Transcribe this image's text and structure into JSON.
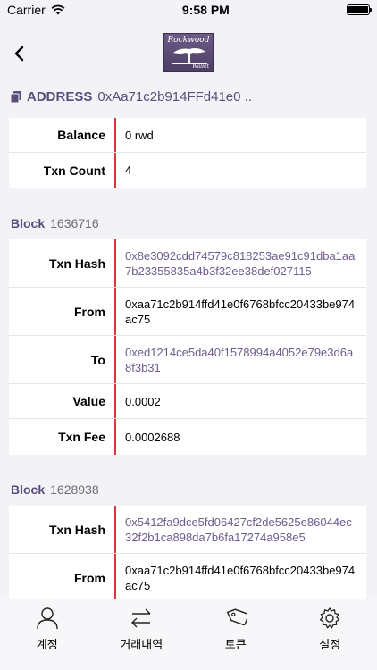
{
  "status": {
    "carrier": "Carrier",
    "time": "9:58 PM"
  },
  "logo": {
    "top_text": "Rockwood",
    "bottom_text": "Wallet"
  },
  "address": {
    "label": "ADDRESS",
    "value": "0xAa71c2b914FFd41e0 .."
  },
  "summary": {
    "rows": [
      {
        "label": "Balance",
        "value": "0 rwd"
      },
      {
        "label": "Txn Count",
        "value": "4"
      }
    ]
  },
  "blocks": [
    {
      "label": "Block",
      "number": "1636716",
      "rows": [
        {
          "label": "Txn Hash",
          "value": "0x8e3092cdd74579c818253ae91c91dba1aa7b23355835a4b3f32ee38def027115"
        },
        {
          "label": "From",
          "value": "0xaa71c2b914ffd41e0f6768bfcc20433be974ac75"
        },
        {
          "label": "To",
          "value": "0xed1214ce5da40f1578994a4052e79e3d6a8f3b31"
        },
        {
          "label": "Value",
          "value": "0.0002"
        },
        {
          "label": "Txn Fee",
          "value": "0.0002688"
        }
      ]
    },
    {
      "label": "Block",
      "number": "1628938",
      "rows": [
        {
          "label": "Txn Hash",
          "value": "0x5412fa9dce5fd06427cf2de5625e86044ec32f2b1ca898da7b6fa17274a958e5"
        },
        {
          "label": "From",
          "value": "0xaa71c2b914ffd41e0f6768bfcc20433be974ac75"
        }
      ]
    }
  ],
  "tabs": [
    {
      "label": "계정",
      "icon": "person-icon"
    },
    {
      "label": "거래내역",
      "icon": "transfer-arrows-icon"
    },
    {
      "label": "토큰",
      "icon": "token-tag-icon"
    },
    {
      "label": "설정",
      "icon": "gear-icon"
    }
  ],
  "colors": {
    "accent": "#5b4e7a",
    "link": "#6e5b8f",
    "divider": "#d23a3a"
  }
}
